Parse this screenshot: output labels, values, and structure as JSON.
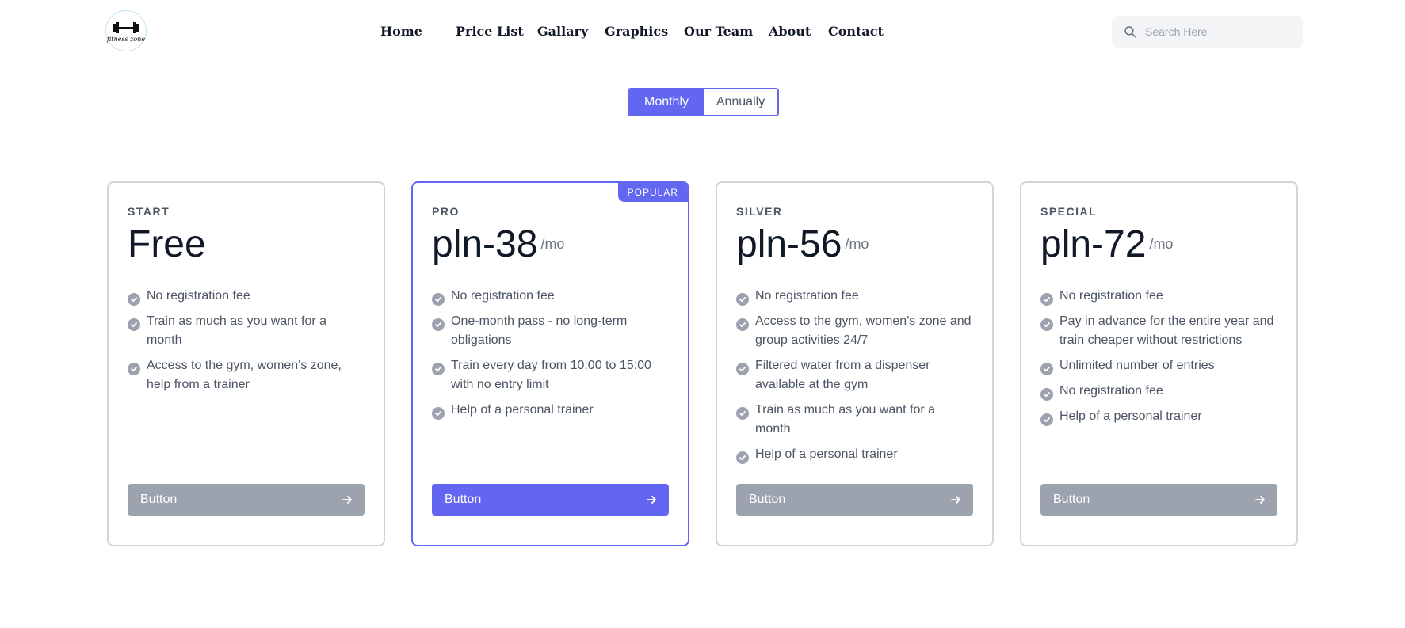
{
  "header": {
    "logo_text": "fitness zone",
    "nav": [
      {
        "label": "Home"
      },
      {
        "label": "Price List"
      },
      {
        "label": "Gallary"
      },
      {
        "label": "Graphics"
      },
      {
        "label": "Our Team"
      },
      {
        "label": "About"
      },
      {
        "label": "Contact"
      }
    ],
    "search": {
      "placeholder": "Search Here",
      "value": ""
    }
  },
  "billing_toggle": {
    "monthly_label": "Monthly",
    "annually_label": "Annually",
    "selected": "Monthly"
  },
  "plans": [
    {
      "name": "START",
      "price": "Free",
      "period": "",
      "features": [
        "No registration fee",
        "Train as much as you want for a month",
        "Access to the gym, women's zone, help from a trainer"
      ],
      "button_label": "Button"
    },
    {
      "name": "PRO",
      "badge": "POPULAR",
      "price": "pln-38",
      "period": "/mo",
      "features": [
        "No registration fee",
        "One-month pass - no long-term obligations",
        "Train every day from 10:00 to 15:00 with no entry limit",
        "Help of a personal trainer"
      ],
      "button_label": "Button"
    },
    {
      "name": "SILVER",
      "price": "pln-56",
      "period": "/mo",
      "features": [
        "No registration fee",
        "Access to the gym, women's zone and group activities 24/7",
        "Filtered water from a dispenser available at the gym",
        "Train as much as you want for a month",
        "Help of a personal trainer"
      ],
      "button_label": "Button"
    },
    {
      "name": "SPECIAL",
      "price": "pln-72",
      "period": "/mo",
      "features": [
        "No registration fee",
        "Pay in advance for the entire year and train cheaper without restrictions",
        "Unlimited number of entries",
        "No registration fee",
        "Help of a personal trainer"
      ],
      "button_label": "Button"
    }
  ],
  "colors": {
    "accent": "#6366f1",
    "muted_button": "#9ca3af",
    "card_border": "#d1d5db",
    "text_muted": "#4b5563"
  },
  "icons": {
    "search": "search-icon",
    "check": "check-circle-icon",
    "arrow": "arrow-right-icon",
    "logo": "dumbbell-icon"
  }
}
